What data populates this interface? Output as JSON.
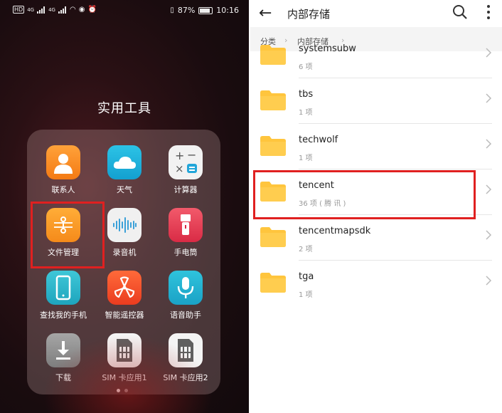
{
  "status": {
    "network_label": "HD",
    "net1": "4G",
    "net2": "4G",
    "battery": "87%",
    "time": "10:16"
  },
  "folder": {
    "title": "实用工具",
    "apps": [
      {
        "label": "联系人",
        "icon": "contacts-icon"
      },
      {
        "label": "天气",
        "icon": "weather-icon"
      },
      {
        "label": "计算器",
        "icon": "calculator-icon"
      },
      {
        "label": "文件管理",
        "icon": "file-manager-icon"
      },
      {
        "label": "录音机",
        "icon": "recorder-icon"
      },
      {
        "label": "手电筒",
        "icon": "flashlight-icon"
      },
      {
        "label": "查找我的手机",
        "icon": "find-phone-icon"
      },
      {
        "label": "智能遥控器",
        "icon": "remote-icon"
      },
      {
        "label": "语音助手",
        "icon": "voice-assistant-icon"
      },
      {
        "label": "下载",
        "icon": "download-icon"
      },
      {
        "label": "SIM 卡应用1",
        "icon": "sim-icon"
      },
      {
        "label": "SIM 卡应用2",
        "icon": "sim-icon"
      }
    ]
  },
  "files": {
    "title": "内部存储",
    "breadcrumb": [
      "分类",
      "内部存储"
    ],
    "rows": [
      {
        "name": "systemsubw",
        "meta": "6 项"
      },
      {
        "name": "tbs",
        "meta": "1 项"
      },
      {
        "name": "techwolf",
        "meta": "1 项"
      },
      {
        "name": "tencent",
        "meta": "36 项 ( 腾 讯 )"
      },
      {
        "name": "tencentmapsdk",
        "meta": "2 项"
      },
      {
        "name": "tga",
        "meta": "1 项"
      }
    ]
  },
  "colors": {
    "folder": "#ffc53d",
    "highlight": "#e02020"
  }
}
